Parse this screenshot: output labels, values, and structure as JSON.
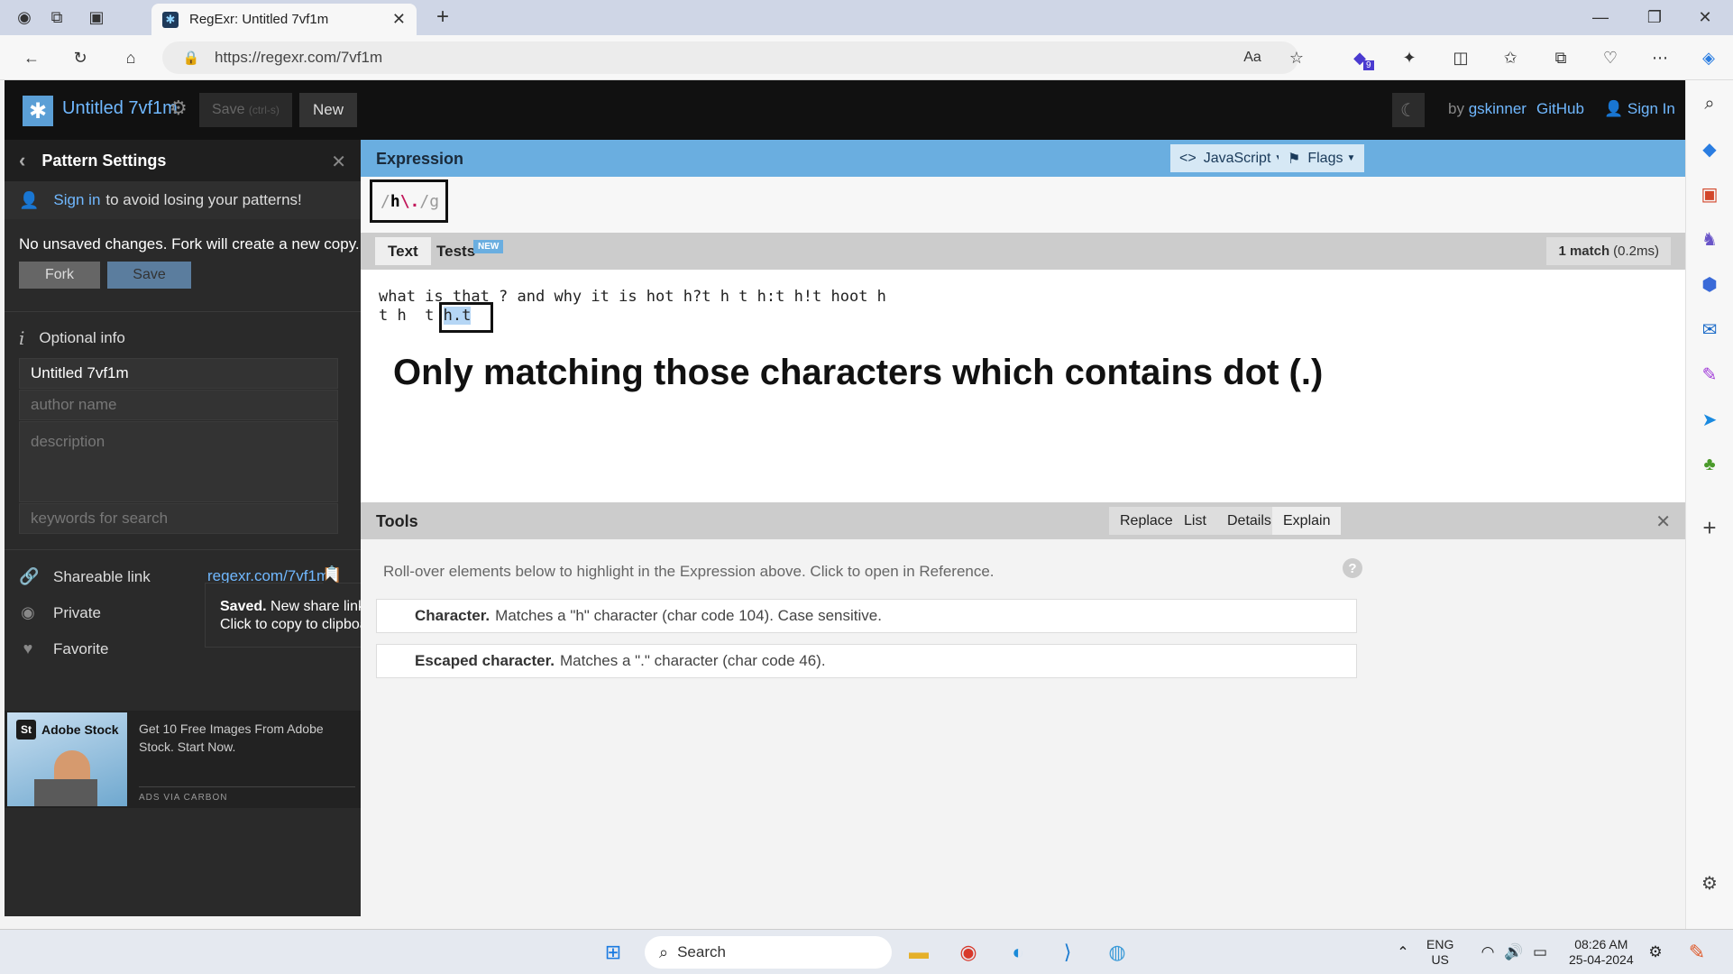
{
  "browser": {
    "tab_title": "RegExr: Untitled 7vf1m",
    "url": "https://regexr.com/7vf1m",
    "extension_badge": "9"
  },
  "app": {
    "doc_title": "Untitled 7vf1m",
    "save_label": "Save",
    "save_shortcut": "(ctrl-s)",
    "new_label": "New",
    "by_label": "by",
    "author": "gskinner",
    "github_label": "GitHub",
    "signin_label": "Sign In"
  },
  "sidebar": {
    "title": "Pattern Settings",
    "signin_link": "Sign in",
    "signin_rest": "to avoid losing your patterns!",
    "notice": "No unsaved changes. Fork will create a new copy.",
    "fork_label": "Fork",
    "save_label": "Save",
    "optional_info": "Optional info",
    "title_value": "Untitled 7vf1m",
    "author_placeholder": "author name",
    "description_placeholder": "description",
    "keywords_placeholder": "keywords for search",
    "shareable_label": "Shareable link",
    "share_url": "regexr.com/7vf1m",
    "private_label": "Private",
    "favorite_label": "Favorite"
  },
  "ad": {
    "brand": "Adobe Stock",
    "brand_mark": "St",
    "text": "Get 10 Free Images From Adobe Stock. Start Now.",
    "via": "ADS VIA CARBON"
  },
  "tooltip": {
    "bold": "Saved.",
    "text": "New share link created. Click to copy to clipboard."
  },
  "expression": {
    "title": "Expression",
    "language_label": "JavaScript",
    "flags_label": "Flags",
    "open_delim": "/",
    "char": "h",
    "escaped": "\\.",
    "close_delim": "/g"
  },
  "text_panel": {
    "tab_text": "Text",
    "tab_tests": "Tests",
    "new_badge": "NEW",
    "match_count": "1 match",
    "match_time": "(0.2ms)",
    "line1": "what is that ? and why it is hot h?t h t h:t h!t hoot h",
    "line2_prefix": "t h  t ",
    "line2_match": "h.t",
    "caption": "Only matching those characters which contains dot (.)"
  },
  "tools": {
    "title": "Tools",
    "buttons": [
      "Replace",
      "List",
      "Details",
      "Explain"
    ],
    "hint": "Roll-over elements below to highlight in the Expression above. Click to open in Reference.",
    "rows": [
      {
        "bold": "Character.",
        "text": "Matches a \"h\" character (char code 104). Case sensitive."
      },
      {
        "bold": "Escaped character.",
        "text": "Matches a \".\" character (char code 46)."
      }
    ]
  },
  "taskbar": {
    "search_placeholder": "Search",
    "lang_top": "ENG",
    "lang_bottom": "US",
    "time": "08:26 AM",
    "date": "25-04-2024"
  },
  "colors": {
    "accent": "#6aaee0",
    "link": "#70b8ff",
    "match_highlight": "#b5d6f5",
    "sidebar_bg": "#2a2a2a"
  }
}
